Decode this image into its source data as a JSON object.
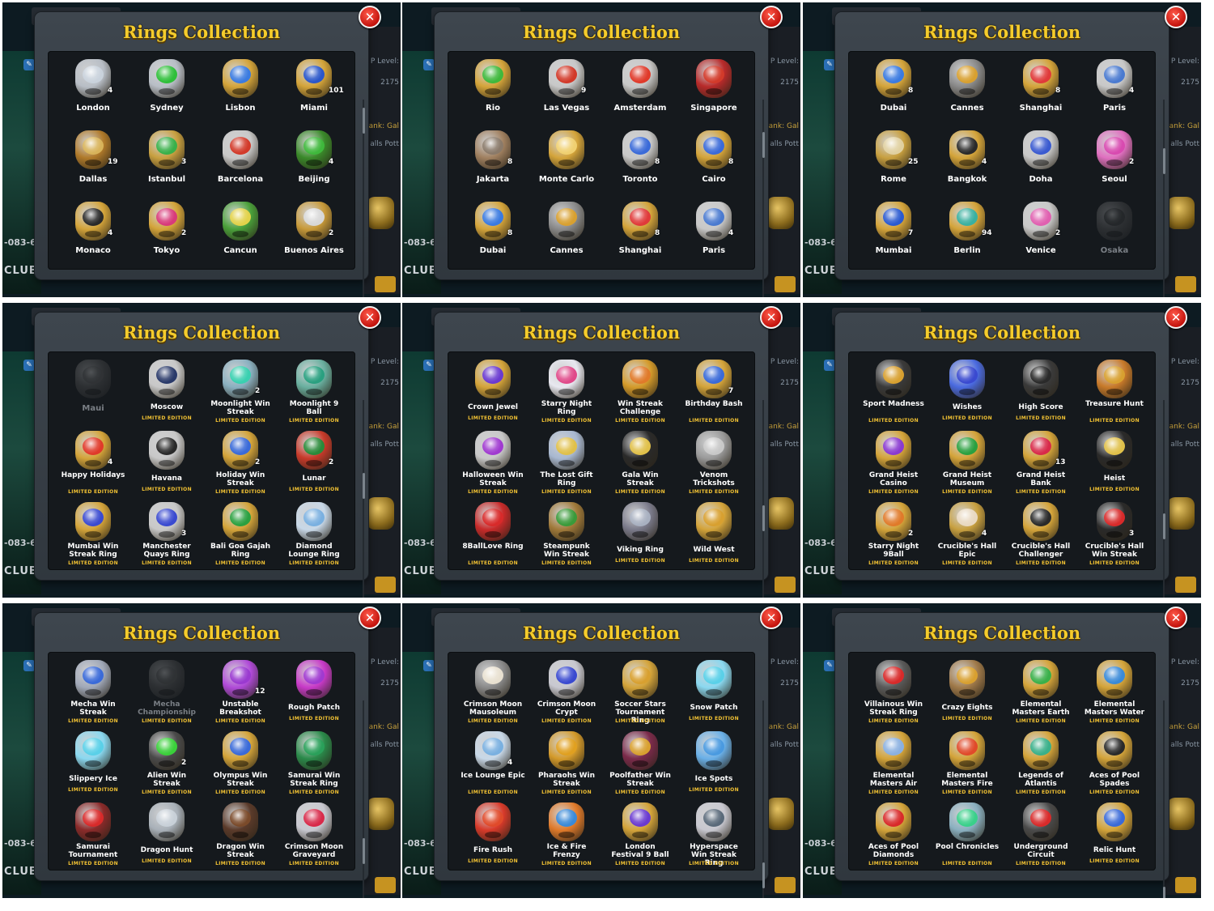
{
  "dialog_title": "Rings Collection",
  "close_glyph": "✕",
  "limited_label": "LIMITED EDITION",
  "background": {
    "club_code": "-083-6",
    "club_label": "CLUB®",
    "level_label": "P Level:",
    "level_value": "2175",
    "rank_label": "ank: Gal",
    "balls_label": "alls Pott"
  },
  "panels": [
    {
      "rings": [
        {
          "name": "London",
          "count": "4",
          "gem": "#c9d2dc",
          "band": "#b8bec6"
        },
        {
          "name": "Sydney",
          "count": "",
          "gem": "#2fbf3a",
          "band": "#b8bec6"
        },
        {
          "name": "Lisbon",
          "count": "",
          "gem": "#3b7be0",
          "band": "#d4a43a"
        },
        {
          "name": "Miami",
          "count": "101",
          "gem": "#2a56c9",
          "band": "#d4a43a"
        },
        {
          "name": "Dallas",
          "count": "19",
          "gem": "#d8b35a",
          "band": "#b07a2a"
        },
        {
          "name": "Istanbul",
          "count": "3",
          "gem": "#39b04a",
          "band": "#c8a040"
        },
        {
          "name": "Barcelona",
          "count": "",
          "gem": "#d23a2a",
          "band": "#c8c8c8"
        },
        {
          "name": "Beijing",
          "count": "4",
          "gem": "#3fb83c",
          "band": "#3a8a2a"
        },
        {
          "name": "Monaco",
          "count": "4",
          "gem": "#2a2a2a",
          "band": "#d4a43a"
        },
        {
          "name": "Tokyo",
          "count": "2",
          "gem": "#d83a7a",
          "band": "#d4a43a"
        },
        {
          "name": "Cancun",
          "count": "",
          "gem": "#e2d24a",
          "band": "#4aa03a"
        },
        {
          "name": "Buenos Aires",
          "count": "2",
          "gem": "#d8d8d8",
          "band": "#c89a3a"
        }
      ]
    },
    {
      "rings": [
        {
          "name": "Rio",
          "count": "",
          "gem": "#3fb83c",
          "band": "#d4a43a"
        },
        {
          "name": "Las Vegas",
          "count": "9",
          "gem": "#d23a2a",
          "band": "#c8c8c8"
        },
        {
          "name": "Amsterdam",
          "count": "",
          "gem": "#e03a2a",
          "band": "#c8c8c8"
        },
        {
          "name": "Singapore",
          "count": "",
          "gem": "#d23a2a",
          "band": "#b82a2a"
        },
        {
          "name": "Jakarta",
          "count": "8",
          "gem": "#8a7a6a",
          "band": "#a08060"
        },
        {
          "name": "Monte Carlo",
          "count": "",
          "gem": "#f0d070",
          "band": "#d4a43a"
        },
        {
          "name": "Toronto",
          "count": "8",
          "gem": "#3a6ad8",
          "band": "#c8c8c8"
        },
        {
          "name": "Cairo",
          "count": "8",
          "gem": "#3a6ad8",
          "band": "#d4a43a"
        },
        {
          "name": "Dubai",
          "count": "8",
          "gem": "#3a7ae0",
          "band": "#d4a43a"
        },
        {
          "name": "Cannes",
          "count": "",
          "gem": "#d8a030",
          "band": "#8a8a8a"
        },
        {
          "name": "Shanghai",
          "count": "8",
          "gem": "#e03a3a",
          "band": "#d4a43a"
        },
        {
          "name": "Paris",
          "count": "4",
          "gem": "#4a7ad0",
          "band": "#c8c8c8"
        }
      ]
    },
    {
      "rings": [
        {
          "name": "Dubai",
          "count": "8",
          "gem": "#3a7ae0",
          "band": "#d4a43a"
        },
        {
          "name": "Cannes",
          "count": "",
          "gem": "#d8a030",
          "band": "#8a8a8a"
        },
        {
          "name": "Shanghai",
          "count": "8",
          "gem": "#e03a3a",
          "band": "#d4a43a"
        },
        {
          "name": "Paris",
          "count": "4",
          "gem": "#4a7ad0",
          "band": "#c8c8c8"
        },
        {
          "name": "Rome",
          "count": "25",
          "gem": "#e0d0a0",
          "band": "#c8a040"
        },
        {
          "name": "Bangkok",
          "count": "4",
          "gem": "#2a2a2a",
          "band": "#d4a43a"
        },
        {
          "name": "Doha",
          "count": "",
          "gem": "#3a5ad0",
          "band": "#c8c8c8"
        },
        {
          "name": "Seoul",
          "count": "2",
          "gem": "#d84ab0",
          "band": "#e070c0"
        },
        {
          "name": "Mumbai",
          "count": "7",
          "gem": "#2a5ad0",
          "band": "#d4a43a"
        },
        {
          "name": "Berlin",
          "count": "94",
          "gem": "#3ab0a0",
          "band": "#d4a43a"
        },
        {
          "name": "Venice",
          "count": "2",
          "gem": "#e060b0",
          "band": "#c8c8c8"
        },
        {
          "name": "Osaka",
          "count": "",
          "gem": "#8a3a4a",
          "band": "#6a6a6a",
          "locked": true
        }
      ]
    },
    {
      "rings": [
        {
          "name": "Maui",
          "count": "",
          "gem": "#6a7a6a",
          "band": "#6a6a6a",
          "locked": true
        },
        {
          "name": "Moscow",
          "count": "",
          "gem": "#2a3a6a",
          "band": "#c8c8c8",
          "limited": true
        },
        {
          "name": "Moonlight Win Streak",
          "count": "2",
          "gem": "#3ad0b0",
          "band": "#8ab0c0",
          "limited": true
        },
        {
          "name": "Moonlight 9 Ball",
          "count": "",
          "gem": "#2aa080",
          "band": "#6ab0a0",
          "limited": true
        },
        {
          "name": "Happy Holidays",
          "count": "4",
          "gem": "#e03a2a",
          "band": "#d4a43a",
          "limited": true
        },
        {
          "name": "Havana",
          "count": "",
          "gem": "#2a2a2a",
          "band": "#c8c8c8",
          "limited": true
        },
        {
          "name": "Holiday Win Streak",
          "count": "2",
          "gem": "#3a6ad8",
          "band": "#d4a43a",
          "limited": true
        },
        {
          "name": "Lunar",
          "count": "2",
          "gem": "#2a8a3a",
          "band": "#c83a2a",
          "limited": true
        },
        {
          "name": "Mumbai Win Streak Ring",
          "count": "",
          "gem": "#3a4ad0",
          "band": "#d4a43a",
          "limited": true
        },
        {
          "name": "Manchester Quays Ring",
          "count": "3",
          "gem": "#3a4ad0",
          "band": "#c8c8c8",
          "limited": true
        },
        {
          "name": "Bali Goa Gajah Ring",
          "count": "",
          "gem": "#2aa040",
          "band": "#d4a43a",
          "limited": true
        },
        {
          "name": "Diamond Lounge Ring",
          "count": "",
          "gem": "#7ab0e0",
          "band": "#c8d8e8",
          "limited": true
        }
      ]
    },
    {
      "rings": [
        {
          "name": "Crown Jewel",
          "count": "",
          "gem": "#6a3ad0",
          "band": "#d4a43a",
          "limited": true
        },
        {
          "name": "Starry Night Ring",
          "count": "",
          "gem": "#e04a8a",
          "band": "#e8e8f0",
          "limited": true
        },
        {
          "name": "Win Streak Challenge",
          "count": "",
          "gem": "#e07a2a",
          "band": "#d49a2a",
          "limited": true
        },
        {
          "name": "Birthday Bash",
          "count": "7",
          "gem": "#3a6ad8",
          "band": "#d4a43a",
          "limited": true
        },
        {
          "name": "Halloween Win Streak",
          "count": "",
          "gem": "#a03ad0",
          "band": "#c8c8c8",
          "limited": true
        },
        {
          "name": "The Lost Gift Ring",
          "count": "",
          "gem": "#e0c04a",
          "band": "#a8b8d0",
          "limited": true
        },
        {
          "name": "Gala Win Streak",
          "count": "",
          "gem": "#e0c04a",
          "band": "#2a2a2a",
          "limited": true
        },
        {
          "name": "Venom Trickshots",
          "count": "",
          "gem": "#c8c8c8",
          "band": "#9a9a9a",
          "limited": true
        },
        {
          "name": "8BallLove Ring",
          "count": "",
          "gem": "#d82a2a",
          "band": "#c82a2a",
          "limited": true
        },
        {
          "name": "Steampunk Win Streak",
          "count": "",
          "gem": "#3a9a3a",
          "band": "#a07a3a",
          "limited": true
        },
        {
          "name": "Viking Ring",
          "count": "",
          "gem": "#a8b0c0",
          "band": "#7a7a8a",
          "limited": true
        },
        {
          "name": "Wild West",
          "count": "",
          "gem": "#d8a030",
          "band": "#d4a43a",
          "limited": true
        }
      ]
    },
    {
      "rings": [
        {
          "name": "Sport Madness",
          "count": "",
          "gem": "#d8a030",
          "band": "#3a3a3a",
          "limited": true
        },
        {
          "name": "Wishes",
          "count": "",
          "gem": "#3a4ad0",
          "band": "#4a6ae0",
          "limited": true
        },
        {
          "name": "High Score",
          "count": "",
          "gem": "#2a2a2a",
          "band": "#3a3a3a",
          "limited": true
        },
        {
          "name": "Treasure Hunt",
          "count": "",
          "gem": "#d8a030",
          "band": "#c87a2a",
          "limited": true
        },
        {
          "name": "Grand Heist Casino",
          "count": "",
          "gem": "#8a3ad0",
          "band": "#d4a43a",
          "limited": true
        },
        {
          "name": "Grand Heist Museum",
          "count": "",
          "gem": "#2aa040",
          "band": "#d4a43a",
          "limited": true
        },
        {
          "name": "Grand Heist Bank",
          "count": "13",
          "gem": "#d82a4a",
          "band": "#d4a43a",
          "limited": true
        },
        {
          "name": "Heist",
          "count": "",
          "gem": "#e0c04a",
          "band": "#2a2a2a",
          "limited": true
        },
        {
          "name": "Starry Night 9Ball",
          "count": "2",
          "gem": "#e07a2a",
          "band": "#d4a43a",
          "limited": true
        },
        {
          "name": "Crucible's Hall Epic",
          "count": "4",
          "gem": "#e8d8c0",
          "band": "#c8a040",
          "limited": true
        },
        {
          "name": "Crucible's Hall Challenger",
          "count": "",
          "gem": "#2a2a2a",
          "band": "#d4a43a",
          "limited": true
        },
        {
          "name": "Crucible's Hall Win Streak",
          "count": "3",
          "gem": "#d82a2a",
          "band": "#2a2a2a",
          "limited": true
        }
      ]
    },
    {
      "rings": [
        {
          "name": "Mecha Win Streak",
          "count": "",
          "gem": "#3a6ad8",
          "band": "#a0a8b8",
          "limited": true
        },
        {
          "name": "Mecha Championship",
          "count": "",
          "gem": "#2a8a5a",
          "band": "#6a6a6a",
          "limited": true,
          "locked": true
        },
        {
          "name": "Unstable Breakshot",
          "count": "12",
          "gem": "#9a3ad0",
          "band": "#b04ad8",
          "limited": true
        },
        {
          "name": "Rough Patch",
          "count": "",
          "gem": "#a03ad0",
          "band": "#c83ac8",
          "limited": true
        },
        {
          "name": "Slippery Ice",
          "count": "",
          "gem": "#5ad0e8",
          "band": "#8ad8f0",
          "limited": true
        },
        {
          "name": "Alien Win Streak",
          "count": "2",
          "gem": "#3ad03a",
          "band": "#4a4a4a",
          "limited": true
        },
        {
          "name": "Olympus Win Streak",
          "count": "",
          "gem": "#3a6ad8",
          "band": "#d4a43a",
          "limited": true
        },
        {
          "name": "Samurai Win Streak Ring",
          "count": "",
          "gem": "#2aa05a",
          "band": "#2a8a4a",
          "limited": true
        },
        {
          "name": "Samurai Tournament",
          "count": "",
          "gem": "#d82a2a",
          "band": "#8a2a2a",
          "limited": true
        },
        {
          "name": "Dragon Hunt",
          "count": "",
          "gem": "#c8d0d8",
          "band": "#a8b0b8",
          "limited": true
        },
        {
          "name": "Dragon Win Streak",
          "count": "",
          "gem": "#7a4a2a",
          "band": "#5a3a2a",
          "limited": true
        },
        {
          "name": "Crimson Moon Graveyard",
          "count": "",
          "gem": "#d82a4a",
          "band": "#c8c8d0",
          "limited": true
        }
      ]
    },
    {
      "rings": [
        {
          "name": "Crimson Moon Mausoleum",
          "count": "",
          "gem": "#e8e0d0",
          "band": "#8a8a8a",
          "limited": true
        },
        {
          "name": "Crimson Moon Crypt",
          "count": "",
          "gem": "#3a4ad0",
          "band": "#c8c8d0",
          "limited": true
        },
        {
          "name": "Soccer Stars Tournament Ring",
          "count": "",
          "gem": "#d8a030",
          "band": "#d4a43a",
          "limited": true
        },
        {
          "name": "Snow Patch",
          "count": "",
          "gem": "#5ad0e8",
          "band": "#8ad8f0",
          "limited": true
        },
        {
          "name": "Ice Lounge Epic",
          "count": "4",
          "gem": "#7ab0e0",
          "band": "#c8d8e8",
          "limited": true
        },
        {
          "name": "Pharaohs Win Streak",
          "count": "",
          "gem": "#e0a020",
          "band": "#d49a2a",
          "limited": true
        },
        {
          "name": "Poolfather Win Streak",
          "count": "",
          "gem": "#d8a030",
          "band": "#7a2a4a",
          "limited": true
        },
        {
          "name": "Ice Spots",
          "count": "",
          "gem": "#4a9ae0",
          "band": "#6ab0e8",
          "limited": true
        },
        {
          "name": "Fire Rush",
          "count": "",
          "gem": "#e04a2a",
          "band": "#d83a2a",
          "limited": true
        },
        {
          "name": "Ice & Fire Frenzy",
          "count": "",
          "gem": "#3a8ad8",
          "band": "#e07a2a",
          "limited": true
        },
        {
          "name": "London Festival 9 Ball",
          "count": "",
          "gem": "#6a3ad0",
          "band": "#d4a43a",
          "limited": true
        },
        {
          "name": "Hyperspace Win Streak Ring",
          "count": "",
          "gem": "#5a6a7a",
          "band": "#c8c8d0",
          "limited": true
        }
      ]
    },
    {
      "rings": [
        {
          "name": "Villainous Win Streak Ring",
          "count": "",
          "gem": "#d82a2a",
          "band": "#5a5a5a",
          "limited": true
        },
        {
          "name": "Crazy Eights",
          "count": "",
          "gem": "#d8a030",
          "band": "#a07a4a",
          "limited": true
        },
        {
          "name": "Elemental Masters Earth",
          "count": "",
          "gem": "#3ab04a",
          "band": "#d4a43a",
          "limited": true
        },
        {
          "name": "Elemental Masters Water",
          "count": "",
          "gem": "#3a8ad8",
          "band": "#d4a43a",
          "limited": true
        },
        {
          "name": "Elemental Masters Air",
          "count": "",
          "gem": "#8ab0e0",
          "band": "#d4a43a",
          "limited": true
        },
        {
          "name": "Elemental Masters Fire",
          "count": "",
          "gem": "#e04a2a",
          "band": "#d4a43a",
          "limited": true
        },
        {
          "name": "Legends of Atlantis",
          "count": "",
          "gem": "#3ab08a",
          "band": "#d4a43a",
          "limited": true
        },
        {
          "name": "Aces of Pool Spades",
          "count": "",
          "gem": "#2a2a2a",
          "band": "#d4a43a",
          "limited": true
        },
        {
          "name": "Aces of Pool Diamonds",
          "count": "",
          "gem": "#d82a2a",
          "band": "#d4a43a",
          "limited": true
        },
        {
          "name": "Pool Chronicles",
          "count": "",
          "gem": "#3ad08a",
          "band": "#8ab0c0",
          "limited": true
        },
        {
          "name": "Underground Circuit",
          "count": "",
          "gem": "#d82a2a",
          "band": "#4a4a4a",
          "limited": true
        },
        {
          "name": "Relic Hunt",
          "count": "",
          "gem": "#3a6ad8",
          "band": "#d4a43a",
          "limited": true
        }
      ]
    }
  ]
}
